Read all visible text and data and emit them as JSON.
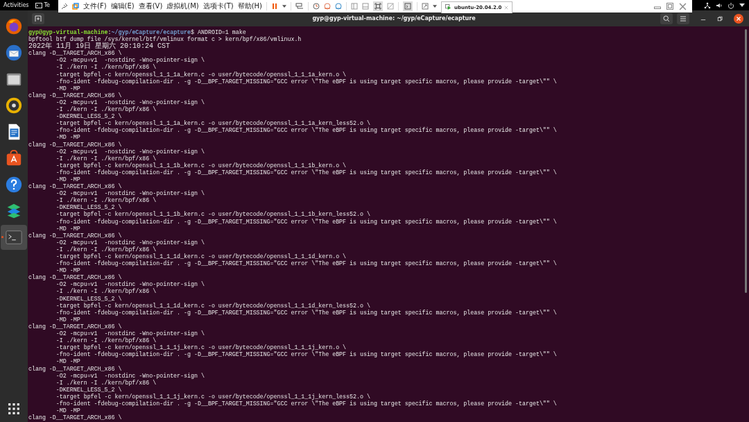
{
  "top_bar": {
    "activities": "Activities",
    "app_menu": "Te"
  },
  "vm_toolbar": {
    "menus": [
      "文件(F)",
      "编辑(E)",
      "查看(V)",
      "虚拟机(M)",
      "选项卡(T)",
      "帮助(H)"
    ],
    "tab": {
      "title": "ubuntu-20.04.2.0",
      "selected": true
    }
  },
  "dock": [
    {
      "kind": "firefox",
      "running": false
    },
    {
      "kind": "thunderbird",
      "running": false
    },
    {
      "kind": "files",
      "running": false
    },
    {
      "kind": "rhythmbox",
      "running": false
    },
    {
      "kind": "writer",
      "running": false
    },
    {
      "kind": "software",
      "running": false
    },
    {
      "kind": "help",
      "running": false
    },
    {
      "kind": "stacks",
      "running": false
    },
    {
      "kind": "terminal",
      "running": true
    }
  ],
  "terminal": {
    "title": "gyp@gyp-virtual-machine: ~/gyp/eCapture/ecapture",
    "prompt": {
      "user_host": "gyp@gyp-virtual-machine",
      "separator": ":",
      "path": "~/gyp/eCapture/ecapture",
      "command": "$ ANDROID=1 make"
    },
    "lines": [
      "bpftool btf dump file /sys/kernel/btf/vmlinux format c > kern/bpf/x86/vmlinux.h",
      "2022年 11月 19日 星期六 20:10:24 CST",
      "clang -D__TARGET_ARCH_x86 \\",
      "        -O2 -mcpu=v1  -nostdinc -Wno-pointer-sign \\",
      "        -I ./kern -I ./kern/bpf/x86 \\",
      "        -target bpfel -c kern/openssl_1_1_1a_kern.c -o user/bytecode/openssl_1_1_1a_kern.o \\",
      "        -fno-ident -fdebug-compilation-dir . -g -D__BPF_TARGET_MISSING=\"GCC error \\\"The eBPF is using target specific macros, please provide -target\\\"\" \\",
      "        -MD -MP",
      "clang -D__TARGET_ARCH_x86 \\",
      "        -O2 -mcpu=v1  -nostdinc -Wno-pointer-sign \\",
      "        -I ./kern -I ./kern/bpf/x86 \\",
      "        -DKERNEL_LESS_5_2 \\",
      "        -target bpfel -c kern/openssl_1_1_1a_kern.c -o user/bytecode/openssl_1_1_1a_kern_less52.o \\",
      "        -fno-ident -fdebug-compilation-dir . -g -D__BPF_TARGET_MISSING=\"GCC error \\\"The eBPF is using target specific macros, please provide -target\\\"\" \\",
      "        -MD -MP",
      "clang -D__TARGET_ARCH_x86 \\",
      "        -O2 -mcpu=v1  -nostdinc -Wno-pointer-sign \\",
      "        -I ./kern -I ./kern/bpf/x86 \\",
      "        -target bpfel -c kern/openssl_1_1_1b_kern.c -o user/bytecode/openssl_1_1_1b_kern.o \\",
      "        -fno-ident -fdebug-compilation-dir . -g -D__BPF_TARGET_MISSING=\"GCC error \\\"The eBPF is using target specific macros, please provide -target\\\"\" \\",
      "        -MD -MP",
      "clang -D__TARGET_ARCH_x86 \\",
      "        -O2 -mcpu=v1  -nostdinc -Wno-pointer-sign \\",
      "        -I ./kern -I ./kern/bpf/x86 \\",
      "        -DKERNEL_LESS_5_2 \\",
      "        -target bpfel -c kern/openssl_1_1_1b_kern.c -o user/bytecode/openssl_1_1_1b_kern_less52.o \\",
      "        -fno-ident -fdebug-compilation-dir . -g -D__BPF_TARGET_MISSING=\"GCC error \\\"The eBPF is using target specific macros, please provide -target\\\"\" \\",
      "        -MD -MP",
      "clang -D__TARGET_ARCH_x86 \\",
      "        -O2 -mcpu=v1  -nostdinc -Wno-pointer-sign \\",
      "        -I ./kern -I ./kern/bpf/x86 \\",
      "        -target bpfel -c kern/openssl_1_1_1d_kern.c -o user/bytecode/openssl_1_1_1d_kern.o \\",
      "        -fno-ident -fdebug-compilation-dir . -g -D__BPF_TARGET_MISSING=\"GCC error \\\"The eBPF is using target specific macros, please provide -target\\\"\" \\",
      "        -MD -MP",
      "clang -D__TARGET_ARCH_x86 \\",
      "        -O2 -mcpu=v1  -nostdinc -Wno-pointer-sign \\",
      "        -I ./kern -I ./kern/bpf/x86 \\",
      "        -DKERNEL_LESS_5_2 \\",
      "        -target bpfel -c kern/openssl_1_1_1d_kern.c -o user/bytecode/openssl_1_1_1d_kern_less52.o \\",
      "        -fno-ident -fdebug-compilation-dir . -g -D__BPF_TARGET_MISSING=\"GCC error \\\"The eBPF is using target specific macros, please provide -target\\\"\" \\",
      "        -MD -MP",
      "clang -D__TARGET_ARCH_x86 \\",
      "        -O2 -mcpu=v1  -nostdinc -Wno-pointer-sign \\",
      "        -I ./kern -I ./kern/bpf/x86 \\",
      "        -target bpfel -c kern/openssl_1_1_1j_kern.c -o user/bytecode/openssl_1_1_1j_kern.o \\",
      "        -fno-ident -fdebug-compilation-dir . -g -D__BPF_TARGET_MISSING=\"GCC error \\\"The eBPF is using target specific macros, please provide -target\\\"\" \\",
      "        -MD -MP",
      "clang -D__TARGET_ARCH_x86 \\",
      "        -O2 -mcpu=v1  -nostdinc -Wno-pointer-sign \\",
      "        -I ./kern -I ./kern/bpf/x86 \\",
      "        -DKERNEL_LESS_5_2 \\",
      "        -target bpfel -c kern/openssl_1_1_1j_kern.c -o user/bytecode/openssl_1_1_1j_kern_less52.o \\",
      "        -fno-ident -fdebug-compilation-dir . -g -D__BPF_TARGET_MISSING=\"GCC error \\\"The eBPF is using target specific macros, please provide -target\\\"\" \\",
      "        -MD -MP",
      "clang -D__TARGET_ARCH_x86 \\"
    ]
  }
}
